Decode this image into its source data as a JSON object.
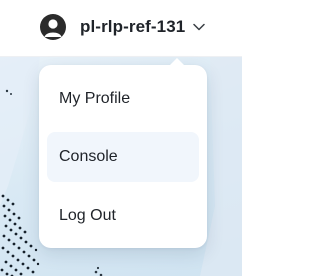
{
  "account": {
    "name": "pl-rlp-ref-131",
    "avatar_icon": "user-icon",
    "chevron_icon": "chevron-down-icon"
  },
  "menu": {
    "items": [
      {
        "label": "My Profile",
        "active": false
      },
      {
        "label": "Console",
        "active": true
      },
      {
        "label": "Log Out",
        "active": false
      }
    ]
  },
  "colors": {
    "text": "#1f2329",
    "active_item_bg": "#f1f6fc",
    "backdrop": "#d9e9f4"
  }
}
